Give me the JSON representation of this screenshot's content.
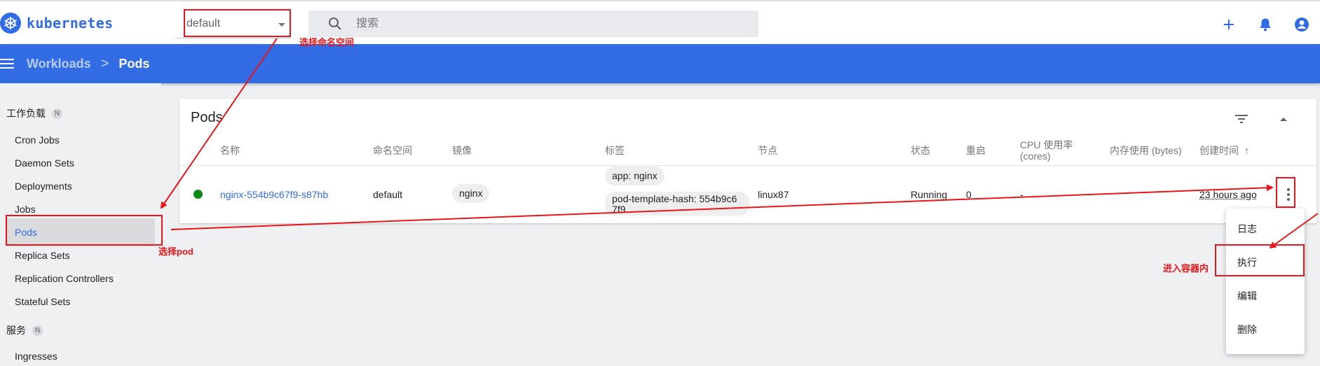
{
  "header": {
    "logo_text": "kubernetes",
    "namespace_value": "default",
    "search_placeholder": "搜索",
    "actions": [
      {
        "icon": "add-icon"
      },
      {
        "icon": "bell-icon"
      },
      {
        "icon": "account-icon"
      }
    ]
  },
  "toolbar": {
    "breadcrumb_parent": "Workloads",
    "breadcrumb_separator": ">",
    "breadcrumb_current": "Pods"
  },
  "sidebar": {
    "sections": [
      {
        "title": "工作负载",
        "badge": "N"
      },
      {
        "title": "服务",
        "badge": "N"
      }
    ],
    "items": [
      {
        "label": "Cron Jobs"
      },
      {
        "label": "Daemon Sets"
      },
      {
        "label": "Deployments"
      },
      {
        "label": "Jobs"
      },
      {
        "label": "Pods",
        "active": true
      },
      {
        "label": "Replica Sets"
      },
      {
        "label": "Replication Controllers"
      },
      {
        "label": "Stateful Sets"
      },
      {
        "label": "Ingresses"
      }
    ]
  },
  "pods_card": {
    "title": "Pods",
    "columns": [
      "名称",
      "命名空间",
      "镜像",
      "标签",
      "节点",
      "状态",
      "重启",
      "CPU 使用率 (cores)",
      "内存使用 (bytes)",
      "创建时间"
    ],
    "sort_indicator": "↑",
    "rows": [
      {
        "name": "nginx-554b9c67f9-s87hb",
        "namespace": "default",
        "image": "nginx",
        "labels": [
          "app: nginx",
          "pod-template-hash: 554b9c67f9"
        ],
        "node": "linux87",
        "status": "Running",
        "restarts": "0",
        "cpu": "-",
        "memory": "",
        "created": "23 hours ago"
      }
    ]
  },
  "context_menu": {
    "items": [
      "日志",
      "执行",
      "编辑",
      "删除"
    ]
  },
  "annotations": {
    "namespace": "选择命名空间",
    "pod": "选择pod",
    "exec": "进入容器内"
  },
  "colors": {
    "brand_blue": "#326ce5",
    "annotation_red": "#e8161a",
    "running_green": "#0a8a16"
  }
}
